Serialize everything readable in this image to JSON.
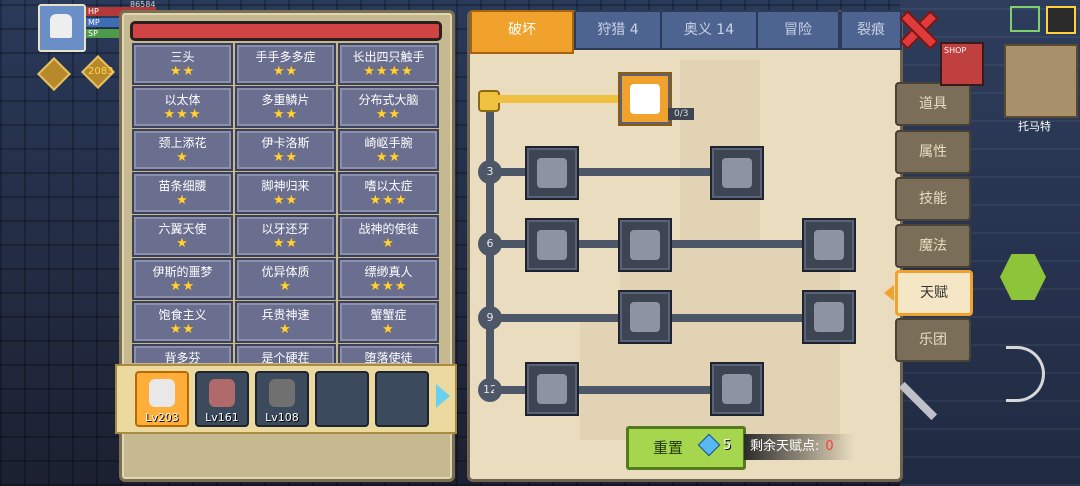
{
  "hud": {
    "hp_label": "HP",
    "mp_label": "MP",
    "sp_label": "SP",
    "level": "203",
    "top_number": "86584",
    "gold": "2083"
  },
  "left": {
    "traits": [
      {
        "name": "三头",
        "stars": "★★"
      },
      {
        "name": "手手多多症",
        "stars": "★★"
      },
      {
        "name": "长出四只触手",
        "stars": "★★★★"
      },
      {
        "name": "以太体",
        "stars": "★★★"
      },
      {
        "name": "多重鳞片",
        "stars": "★★"
      },
      {
        "name": "分布式大脑",
        "stars": "★★"
      },
      {
        "name": "颈上添花",
        "stars": "★"
      },
      {
        "name": "伊卡洛斯",
        "stars": "★★"
      },
      {
        "name": "崎岖手腕",
        "stars": "★★"
      },
      {
        "name": "苗条细腰",
        "stars": "★"
      },
      {
        "name": "脚神归来",
        "stars": "★★"
      },
      {
        "name": "嗜以太症",
        "stars": "★★★"
      },
      {
        "name": "六翼天使",
        "stars": "★"
      },
      {
        "name": "以牙还牙",
        "stars": "★★"
      },
      {
        "name": "战神的使徒",
        "stars": "★"
      },
      {
        "name": "伊斯的噩梦",
        "stars": "★★"
      },
      {
        "name": "优异体质",
        "stars": "★"
      },
      {
        "name": "缥缈真人",
        "stars": "★★★"
      },
      {
        "name": "饱食主义",
        "stars": "★★"
      },
      {
        "name": "兵贵神速",
        "stars": "★"
      },
      {
        "name": "蟹蟹症",
        "stars": "★"
      },
      {
        "name": "背多芬",
        "stars": ""
      },
      {
        "name": "是个硬茬",
        "stars": ""
      },
      {
        "name": "堕落使徒",
        "stars": ""
      }
    ],
    "party": [
      {
        "level": "Lv203"
      },
      {
        "level": "Lv161"
      },
      {
        "level": "Lv108"
      },
      {
        "level": ""
      },
      {
        "level": ""
      }
    ]
  },
  "tabs": [
    {
      "label": "破坏"
    },
    {
      "label": "狩猎 4"
    },
    {
      "label": "奥义 14"
    },
    {
      "label": "冒险"
    },
    {
      "label": "裂痕"
    }
  ],
  "tree": {
    "progress": "0/3",
    "levels": [
      "3",
      "6",
      "9",
      "12"
    ]
  },
  "reset": {
    "label": "重置",
    "cost": "5"
  },
  "remaining": {
    "label": "剩余天赋点:",
    "value": "0"
  },
  "side_menu": [
    {
      "label": "道具"
    },
    {
      "label": "属性"
    },
    {
      "label": "技能"
    },
    {
      "label": "魔法"
    },
    {
      "label": "天赋"
    },
    {
      "label": "乐团"
    }
  ],
  "map": {
    "location": "托马特",
    "shop_label": "SHOP"
  },
  "colors": {
    "accent": "#f0a22c",
    "active_tab": "#f0a22c",
    "reset_green": "#a6d64e",
    "points_red": "#ff3a3a"
  }
}
